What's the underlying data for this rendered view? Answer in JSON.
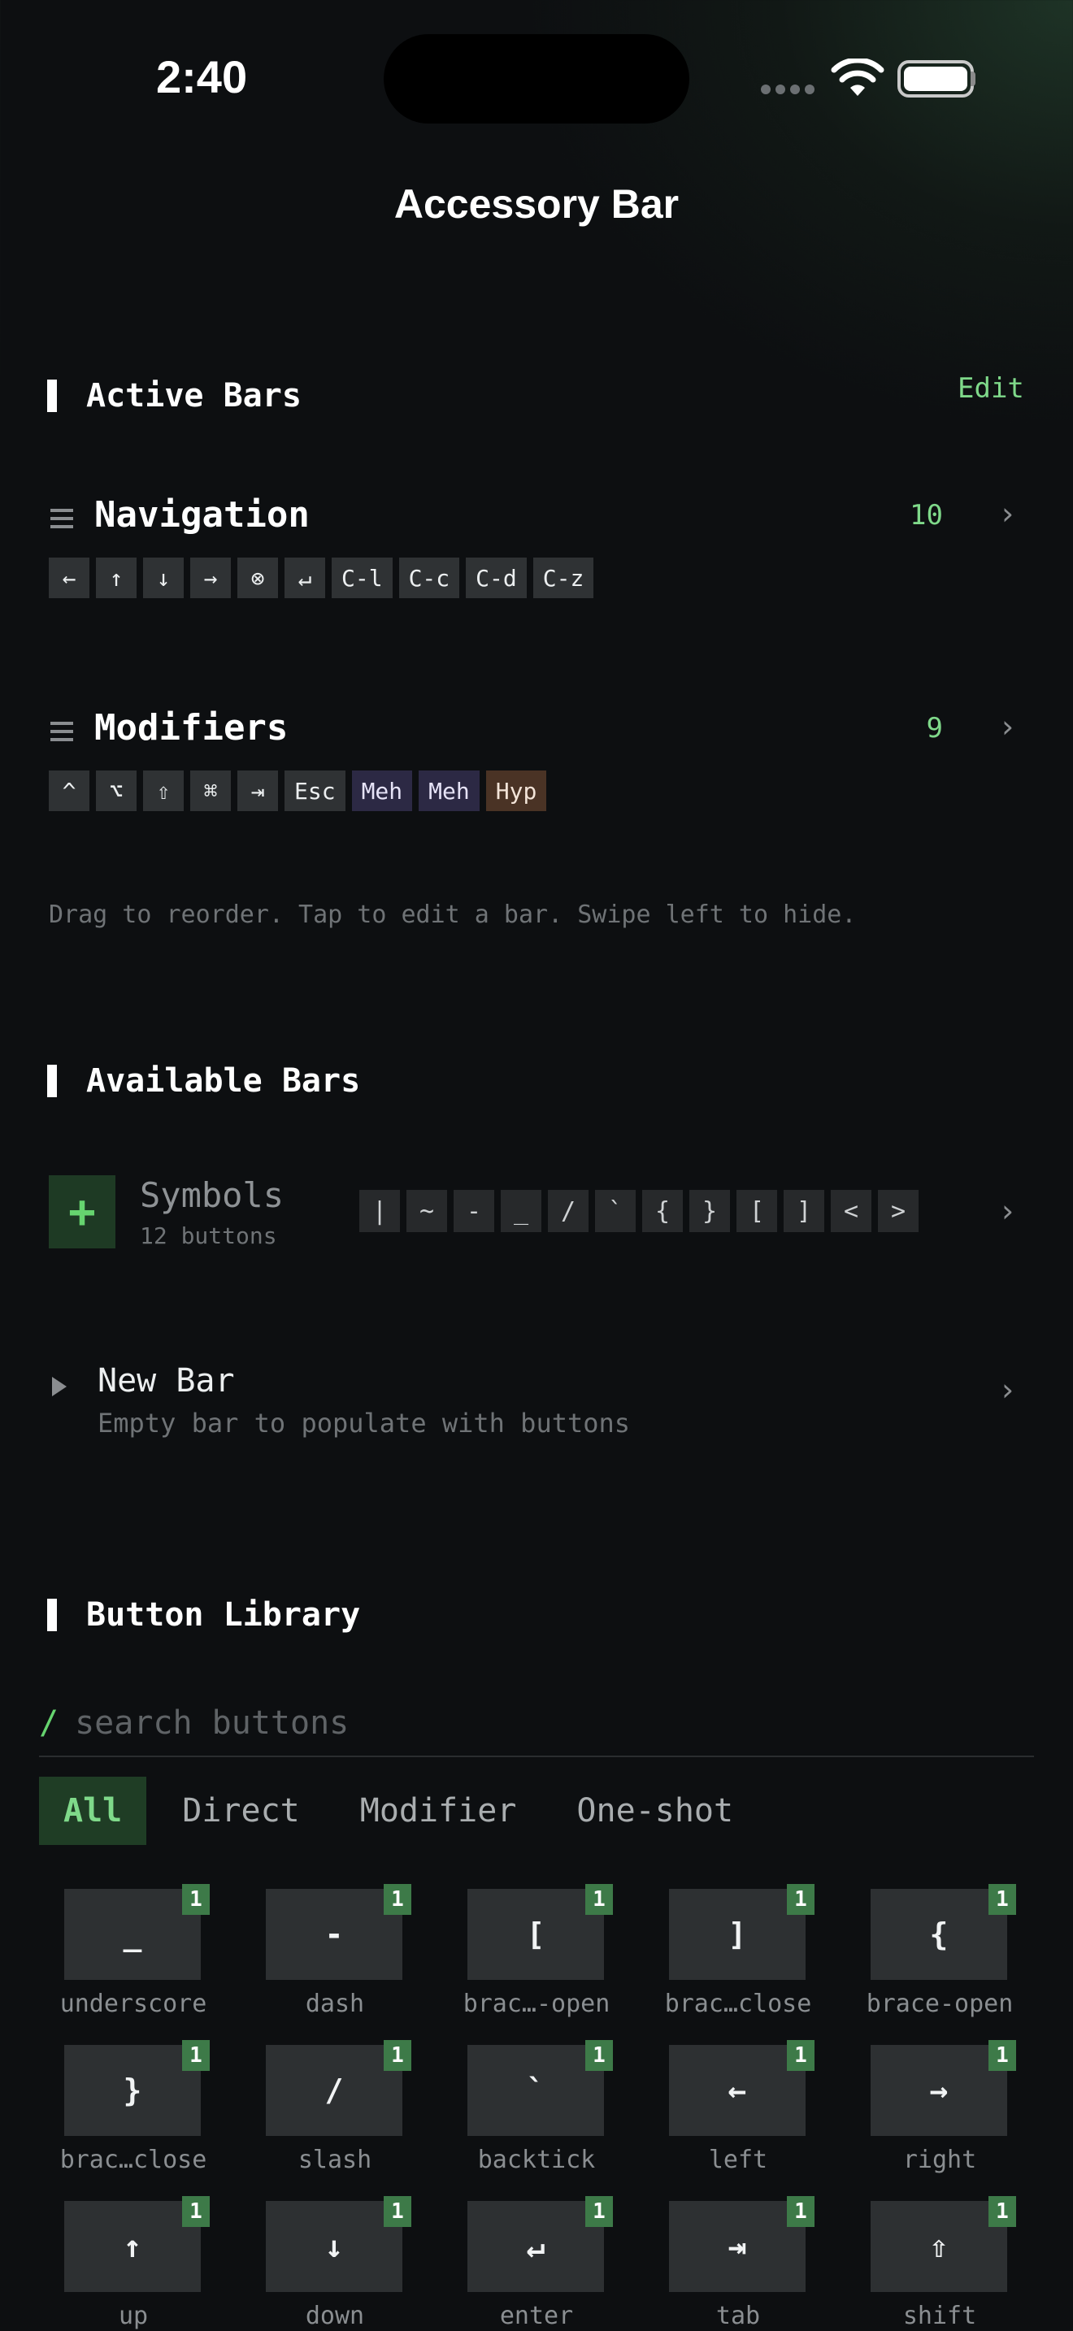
{
  "status_bar": {
    "time": "2:40"
  },
  "nav": {
    "title": "Accessory Bar"
  },
  "active": {
    "section_label": "Active Bars",
    "edit_label": "Edit",
    "bars": [
      {
        "name": "Navigation",
        "count": "10",
        "keys": [
          {
            "label": "←",
            "style": "normal"
          },
          {
            "label": "↑",
            "style": "normal"
          },
          {
            "label": "↓",
            "style": "normal"
          },
          {
            "label": "→",
            "style": "normal"
          },
          {
            "label": "⊗",
            "style": "normal"
          },
          {
            "label": "↵",
            "style": "normal"
          },
          {
            "label": "C-l",
            "style": "normal"
          },
          {
            "label": "C-c",
            "style": "normal"
          },
          {
            "label": "C-d",
            "style": "normal"
          },
          {
            "label": "C-z",
            "style": "normal"
          }
        ]
      },
      {
        "name": "Modifiers",
        "count": "9",
        "keys": [
          {
            "label": "^",
            "style": "normal"
          },
          {
            "label": "⌥",
            "style": "normal"
          },
          {
            "label": "⇧",
            "style": "normal"
          },
          {
            "label": "⌘",
            "style": "normal"
          },
          {
            "label": "⇥",
            "style": "normal"
          },
          {
            "label": "Esc",
            "style": "normal"
          },
          {
            "label": "Meh",
            "style": "purple"
          },
          {
            "label": "Meh",
            "style": "purple"
          },
          {
            "label": "Hyp",
            "style": "brown"
          }
        ]
      }
    ],
    "hint": "Drag to reorder. Tap to edit a bar. Swipe left to hide."
  },
  "available": {
    "section_label": "Available Bars",
    "symbols": {
      "plus": "+",
      "name": "Symbols",
      "subtitle": "12 buttons",
      "keys": [
        "|",
        "~",
        "-",
        "_",
        "/",
        "`",
        "{",
        "}",
        "[",
        "]",
        "<",
        ">"
      ]
    },
    "new_bar": {
      "name": "New Bar",
      "subtitle": "Empty bar to populate with buttons"
    }
  },
  "library": {
    "section_label": "Button Library",
    "search": {
      "prefix": "/",
      "placeholder": "search buttons"
    },
    "tabs": [
      "All",
      "Direct",
      "Modifier",
      "One-shot"
    ],
    "active_tab": "All",
    "buttons": [
      {
        "glyph": "_",
        "caption": "underscore",
        "badge": "1"
      },
      {
        "glyph": "-",
        "caption": "dash",
        "badge": "1"
      },
      {
        "glyph": "[",
        "caption": "brac…-open",
        "badge": "1"
      },
      {
        "glyph": "]",
        "caption": "brac…close",
        "badge": "1"
      },
      {
        "glyph": "{",
        "caption": "brace-open",
        "badge": "1"
      },
      {
        "glyph": "}",
        "caption": "brac…close",
        "badge": "1"
      },
      {
        "glyph": "/",
        "caption": "slash",
        "badge": "1"
      },
      {
        "glyph": "`",
        "caption": "backtick",
        "badge": "1"
      },
      {
        "glyph": "←",
        "caption": "left",
        "badge": "1"
      },
      {
        "glyph": "→",
        "caption": "right",
        "badge": "1"
      },
      {
        "glyph": "↑",
        "caption": "up",
        "badge": "1"
      },
      {
        "glyph": "↓",
        "caption": "down",
        "badge": "1"
      },
      {
        "glyph": "↵",
        "caption": "enter",
        "badge": "1"
      },
      {
        "glyph": "⇥",
        "caption": "tab",
        "badge": "1"
      },
      {
        "glyph": "⇧",
        "caption": "shift",
        "badge": "1"
      }
    ]
  },
  "colors": {
    "accent_green": "#7fd98a",
    "modifier_purple": "#2c2944",
    "hyper_brown": "#4a3325",
    "badge_green": "#3d7a48",
    "background": "#0d0f11"
  }
}
